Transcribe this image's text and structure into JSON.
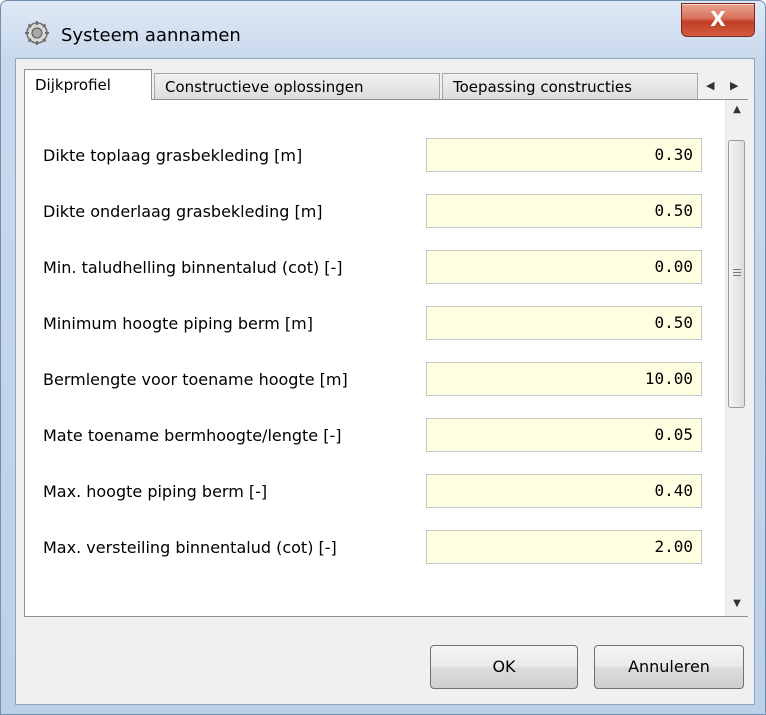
{
  "window": {
    "title": "Systeem aannamen",
    "close_label": "X"
  },
  "tabs": [
    "Dijkprofiel",
    "Constructieve oplossingen",
    "Toepassing constructies"
  ],
  "tab_scroll": {
    "left": "◀",
    "right": "▶"
  },
  "rows": [
    {
      "label": "Dikte toplaag grasbekleding [m]",
      "value": "0.30"
    },
    {
      "label": "Dikte onderlaag grasbekleding [m]",
      "value": "0.50"
    },
    {
      "label": "Min. taludhelling binnentalud (cot) [-]",
      "value": "0.00"
    },
    {
      "label": "Minimum hoogte piping berm [m]",
      "value": "0.50"
    },
    {
      "label": "Bermlengte voor toename hoogte [m]",
      "value": "10.00"
    },
    {
      "label": "Mate toename bermhoogte/lengte [-]",
      "value": "0.05"
    },
    {
      "label": "Max. hoogte piping berm [-]",
      "value": "0.40"
    },
    {
      "label": "Max. versteiling binnentalud (cot) [-]",
      "value": "2.00"
    }
  ],
  "scrollbar": {
    "up": "▲",
    "down": "▼"
  },
  "buttons": {
    "ok": "OK",
    "cancel": "Annuleren"
  }
}
